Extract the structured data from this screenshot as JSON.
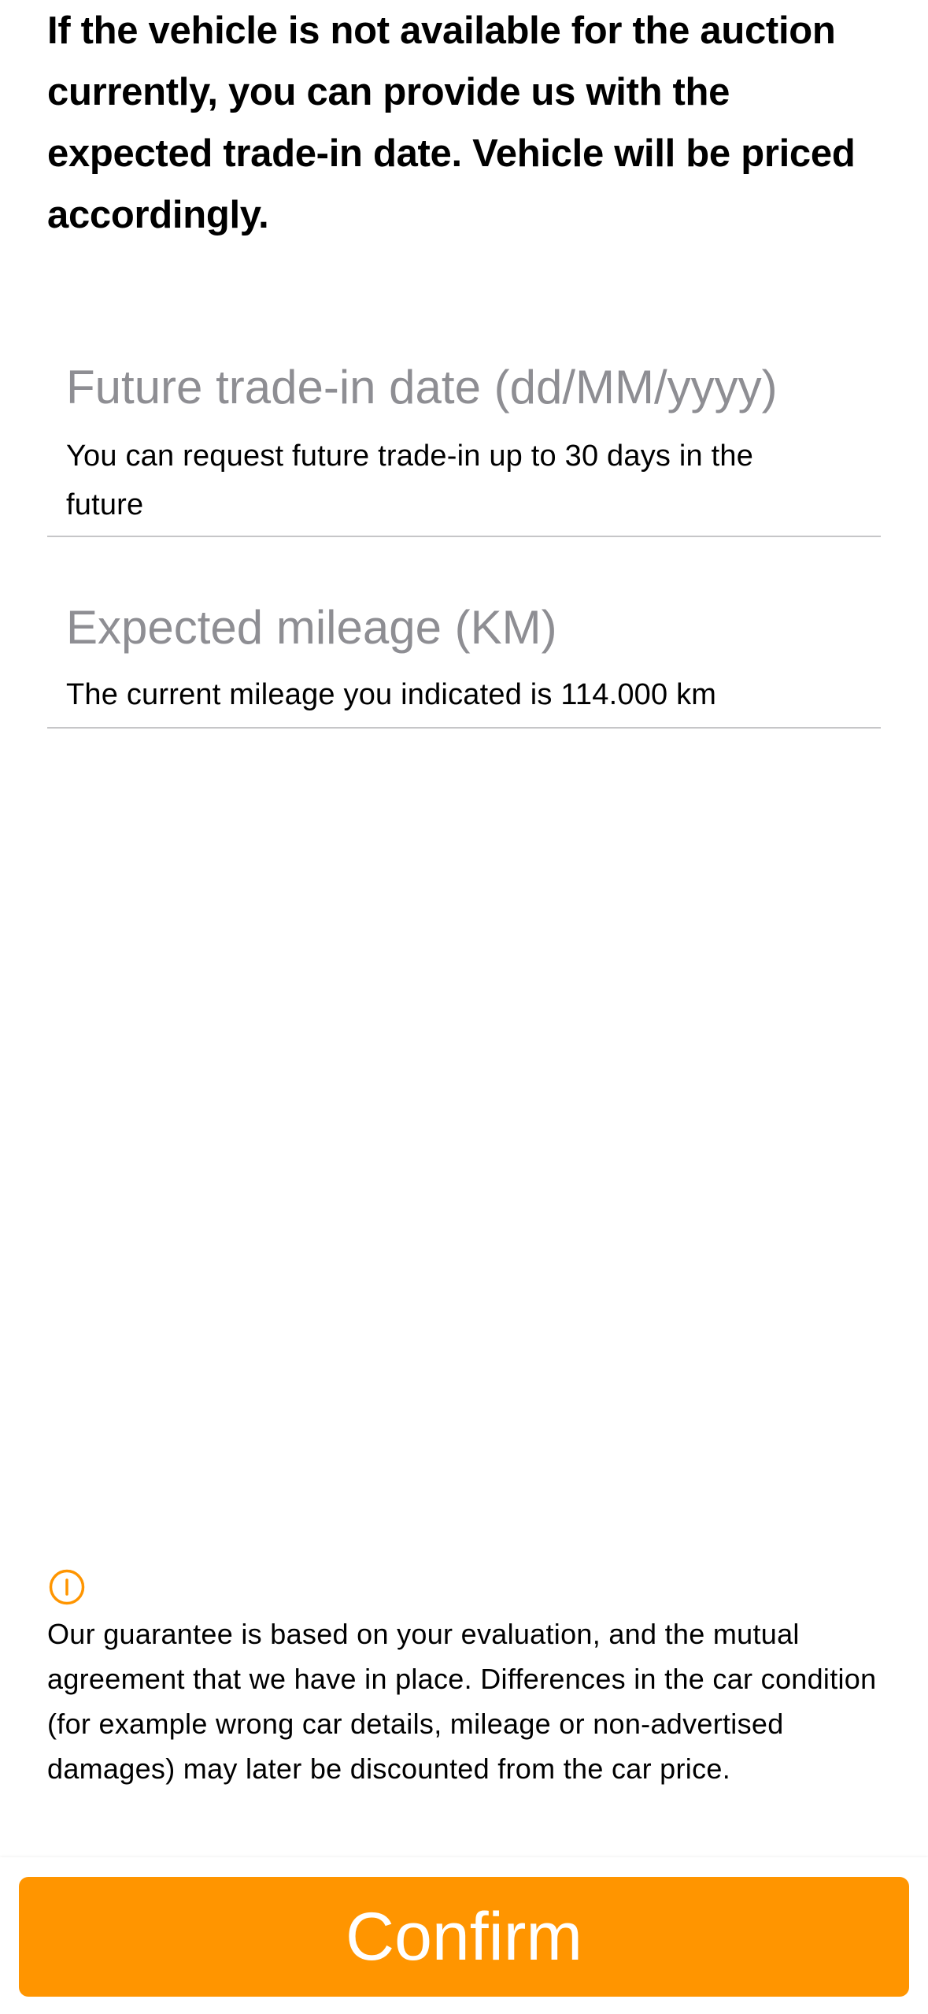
{
  "intro_text": "If the vehicle is not available for the auction currently, you can provide us with the expected trade-in date. Vehicle will be priced accordingly.",
  "future_date_field": {
    "placeholder": "Future trade-in date (dd/MM/yyyy)",
    "value": "",
    "hint": "You can request future trade-in up to 30 days in the future"
  },
  "mileage_field": {
    "placeholder": "Expected mileage (KM)",
    "value": "",
    "hint": "The current mileage you indicated is 114.000 km"
  },
  "notice": {
    "icon": "info-circle-icon",
    "icon_color": "#ff9500",
    "text": "Our guarantee is based on your evaluation, and the mutual agreement that we have in place. Differences in the car condition (for example wrong car details, mileage or non-advertised damages) may later be discounted from the car price."
  },
  "confirm_button": {
    "label": "Confirm",
    "background": "#ff9500",
    "text_color": "#ffffff"
  }
}
